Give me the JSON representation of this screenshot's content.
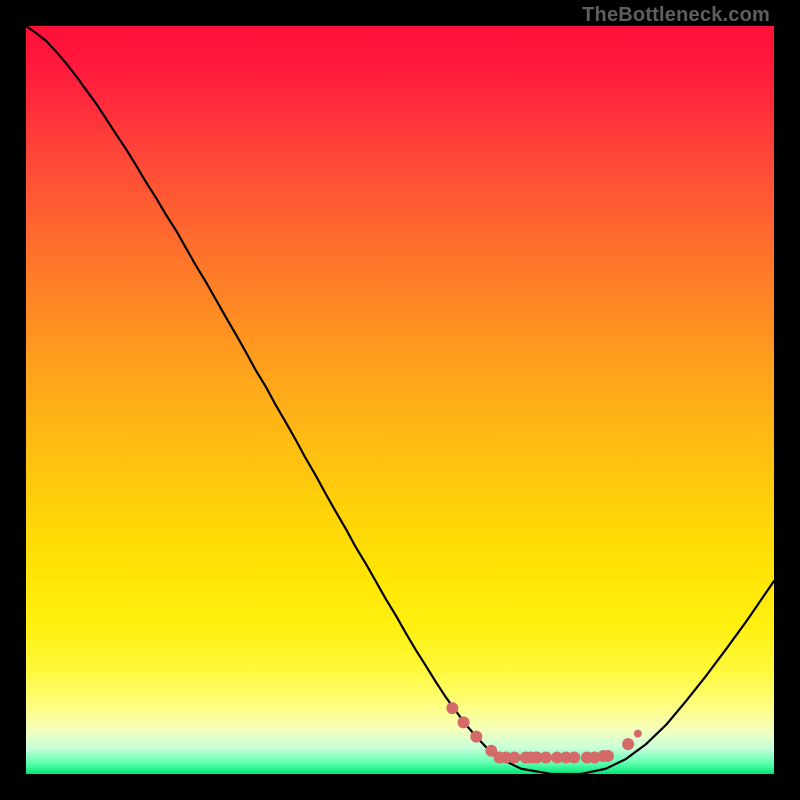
{
  "attribution": "TheBottleneck.com",
  "chart_data": {
    "type": "line",
    "title": "",
    "xlabel": "",
    "ylabel": "",
    "xlim": [
      0,
      100
    ],
    "ylim": [
      0,
      100
    ],
    "gradient": {
      "stops": [
        {
          "offset": 0.0,
          "color": "#ff1038"
        },
        {
          "offset": 0.05,
          "color": "#ff183c"
        },
        {
          "offset": 0.1,
          "color": "#ff2a3c"
        },
        {
          "offset": 0.18,
          "color": "#ff4838"
        },
        {
          "offset": 0.26,
          "color": "#ff6330"
        },
        {
          "offset": 0.34,
          "color": "#ff7d28"
        },
        {
          "offset": 0.42,
          "color": "#ff9620"
        },
        {
          "offset": 0.5,
          "color": "#ffad18"
        },
        {
          "offset": 0.58,
          "color": "#ffc210"
        },
        {
          "offset": 0.66,
          "color": "#ffd508"
        },
        {
          "offset": 0.73,
          "color": "#ffe404"
        },
        {
          "offset": 0.8,
          "color": "#fff010"
        },
        {
          "offset": 0.86,
          "color": "#fff83a"
        },
        {
          "offset": 0.9,
          "color": "#fffd70"
        },
        {
          "offset": 0.94,
          "color": "#f6ffba"
        },
        {
          "offset": 0.965,
          "color": "#c8ffda"
        },
        {
          "offset": 0.985,
          "color": "#60ffb0"
        },
        {
          "offset": 1.0,
          "color": "#00e878"
        }
      ]
    },
    "series": [
      {
        "name": "bottleneck-curve",
        "color": "#000000",
        "x": [
          0.0,
          1.3,
          2.7,
          4.0,
          5.3,
          6.7,
          8.0,
          9.4,
          10.7,
          12.0,
          13.4,
          14.7,
          16.0,
          17.4,
          18.7,
          20.1,
          21.4,
          22.7,
          24.1,
          25.4,
          26.7,
          28.1,
          29.4,
          30.7,
          32.1,
          33.4,
          34.8,
          36.1,
          37.4,
          38.8,
          40.1,
          41.4,
          42.8,
          44.1,
          45.5,
          46.8,
          48.1,
          49.5,
          50.8,
          52.1,
          53.5,
          54.8,
          56.1,
          58.8,
          60.2,
          61.5,
          63.5,
          66.2,
          70.2,
          74.2,
          77.5,
          80.2,
          82.9,
          85.6,
          88.2,
          90.9,
          93.6,
          96.3,
          98.9,
          100.0
        ],
        "y": [
          100.0,
          99.1,
          98.0,
          96.6,
          95.1,
          93.3,
          91.5,
          89.6,
          87.6,
          85.6,
          83.5,
          81.4,
          79.2,
          77.0,
          74.8,
          72.6,
          70.3,
          68.0,
          65.7,
          63.4,
          61.1,
          58.7,
          56.4,
          54.0,
          51.7,
          49.3,
          46.9,
          44.6,
          42.2,
          39.8,
          37.4,
          35.1,
          32.7,
          30.3,
          28.0,
          25.7,
          23.4,
          21.1,
          18.8,
          16.6,
          14.4,
          12.3,
          10.3,
          6.6,
          5.0,
          3.6,
          2.0,
          0.7,
          0.0,
          0.0,
          0.7,
          2.0,
          4.0,
          6.6,
          9.7,
          13.1,
          16.7,
          20.4,
          24.2,
          25.8
        ]
      }
    ],
    "markers": {
      "name": "highlight-points",
      "color": "#d46a6a",
      "x": [
        57.0,
        58.5,
        60.2,
        62.2,
        63.3,
        64.2,
        65.3,
        66.8,
        67.5,
        68.3,
        69.5,
        71.0,
        72.2,
        73.3,
        75.0,
        76.0,
        77.2,
        77.8,
        80.5,
        81.8
      ],
      "y": [
        8.8,
        6.9,
        5.0,
        3.1,
        2.2,
        2.2,
        2.2,
        2.2,
        2.2,
        2.2,
        2.2,
        2.2,
        2.2,
        2.2,
        2.2,
        2.2,
        2.4,
        2.4,
        4.0,
        5.4
      ],
      "radius": [
        6,
        6,
        6,
        6,
        6,
        6,
        6,
        6,
        6,
        6,
        6,
        6,
        6,
        6,
        6,
        6,
        6,
        6,
        6,
        4
      ]
    }
  }
}
